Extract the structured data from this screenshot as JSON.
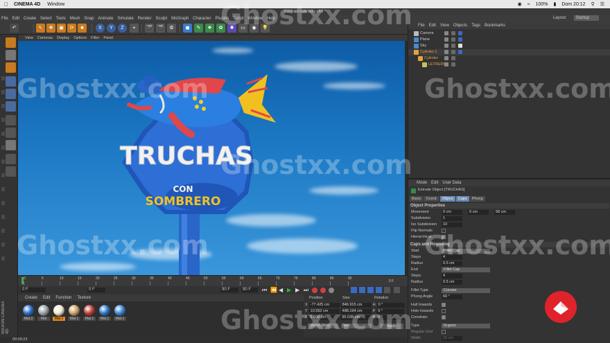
{
  "mac_menubar": {
    "app": "CINEMA 4D",
    "menu": [
      "Window"
    ],
    "battery": "100%",
    "clock": "Dom 20:12"
  },
  "window_title": "trucha modelado.c4d *",
  "app_menu": [
    "File",
    "Edit",
    "Create",
    "Select",
    "Tools",
    "Mesh",
    "Snap",
    "Animate",
    "Simulate",
    "Render",
    "Sculpt",
    "MoGraph",
    "Character",
    "Plugins",
    "Script",
    "Window",
    "Help"
  ],
  "layout": {
    "label": "Layout:",
    "value": "Startup"
  },
  "toolbar": {
    "axis_x": "X",
    "axis_y": "Y",
    "axis_z": "Z"
  },
  "viewport": {
    "menu": [
      "View",
      "Cameras",
      "Display",
      "Options",
      "Filter",
      "Panel"
    ],
    "sign_title": "TRUCHAS",
    "sign_con": "CON",
    "sign_sombrero": "SOMBRERO"
  },
  "timeline": {
    "ticks": [
      "0",
      "5",
      "10",
      "15",
      "20",
      "25",
      "30",
      "35",
      "40",
      "45",
      "50",
      "55",
      "60",
      "65",
      "70",
      "75",
      "80",
      "85",
      "90"
    ],
    "end_label": "0 F",
    "start_field": "0 F",
    "min_field": "0 F",
    "max_field": "90 F",
    "end_field": "90 F"
  },
  "materials": {
    "menu": [
      "Create",
      "Edit",
      "Function",
      "Texture"
    ],
    "items": [
      {
        "name": "Mat.2",
        "color": "#2a6fcc"
      },
      {
        "name": "Mat",
        "color": "#9ea2a8"
      },
      {
        "name": "Mat.1",
        "color": "#f0e8d4"
      },
      {
        "name": "Mat.1",
        "color": "#cfa068"
      },
      {
        "name": "Mat.1",
        "color": "#c0403a"
      },
      {
        "name": "Mat.1",
        "color": "#2c78c8"
      },
      {
        "name": "Mat.1",
        "color": "#3a8ad8"
      }
    ]
  },
  "coords": {
    "headers": [
      "Position",
      "Size",
      "Rotation"
    ],
    "rows": [
      {
        "axis": "X",
        "pos": "-77.425 cm",
        "size": "846.915 cm",
        "rot_axis": "H",
        "rot": "0 °"
      },
      {
        "axis": "Y",
        "pos": "10.592 cm",
        "size": "488.194 cm",
        "rot_axis": "P",
        "rot": "0 °"
      },
      {
        "axis": "Z",
        "pos": "5.098 cm",
        "size": "95.038 cm",
        "rot_axis": "B",
        "rot": "0 °"
      }
    ],
    "mode": "Object (Rel)",
    "size_mode": "Size",
    "apply": "Apply"
  },
  "status": "00:00:23",
  "objects": {
    "menu": [
      "File",
      "Edit",
      "View",
      "Objects",
      "Tags",
      "Bookmarks"
    ],
    "items": [
      {
        "name": "Camera",
        "color": "#ccc"
      },
      {
        "name": "Plane",
        "color": "#ccc"
      },
      {
        "name": "Sky",
        "color": "#ccc"
      },
      {
        "name": "Cylinder.1",
        "color": "#e8a040"
      },
      {
        "name": "Cylinder",
        "color": "#e8a040"
      },
      {
        "name": "LETRERO",
        "color": "#e8a040"
      }
    ]
  },
  "attributes": {
    "menu": [
      "Mode",
      "Edit",
      "User Data"
    ],
    "object_name": "Extrude Object [TRUCHAS]",
    "tabs": [
      "Basic",
      "Coord.",
      "Object",
      "Caps",
      "Phong"
    ],
    "section_object": "Object Properties",
    "movement_label": "Movement",
    "movement": [
      "0 cm",
      "0 cm",
      "58 cm"
    ],
    "subdivision_label": "Subdivision",
    "subdivision": "1",
    "iso_label": "Iso Subdivision",
    "iso": "10",
    "flip_label": "Flip Normals",
    "hier_label": "Hierarchical",
    "section_caps": "Caps and Rounding",
    "start_label": "Start",
    "start": "Fillet Cap",
    "steps_label": "Steps",
    "steps1": "4",
    "radius_label": "Radius",
    "radius1": "0.5 cm",
    "end_label": "End",
    "end": "Fillet Cap",
    "steps2": "4",
    "radius2": "0.5 cm",
    "fillet_label": "Fillet Type",
    "fillet": "Convex",
    "phong_label": "Phong Angle",
    "phong": "60 °",
    "hull_label": "Hull Inwards",
    "hole_label": "Hole Inwards",
    "constrain_label": "Constrain",
    "type_label": "Type",
    "type": "N-gons",
    "regular_label": "Regular Grid",
    "width_label": "Width",
    "width": "10 cm"
  },
  "sidebar_brand": "MAXON CINEMA 4D",
  "watermark": "Ghostxx.com"
}
